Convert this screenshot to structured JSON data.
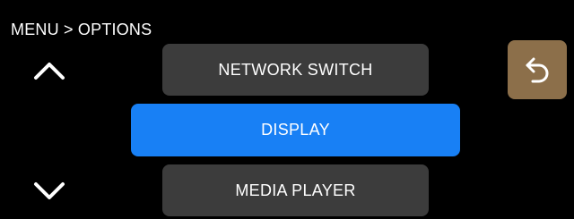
{
  "breadcrumb": "MENU > OPTIONS",
  "navigation": {
    "up_icon": "chevron-up-icon",
    "down_icon": "chevron-down-icon"
  },
  "menu": {
    "items": [
      {
        "label": "NETWORK SWITCH",
        "selected": false
      },
      {
        "label": "DISPLAY",
        "selected": true
      },
      {
        "label": "MEDIA PLAYER",
        "selected": false
      }
    ]
  },
  "back_button": {
    "icon": "back-arrow-icon"
  },
  "colors": {
    "background": "#000000",
    "item_default": "#3c3c3c",
    "item_selected": "#1880f5",
    "back_button": "#8c6f4a",
    "text": "#ffffff"
  }
}
